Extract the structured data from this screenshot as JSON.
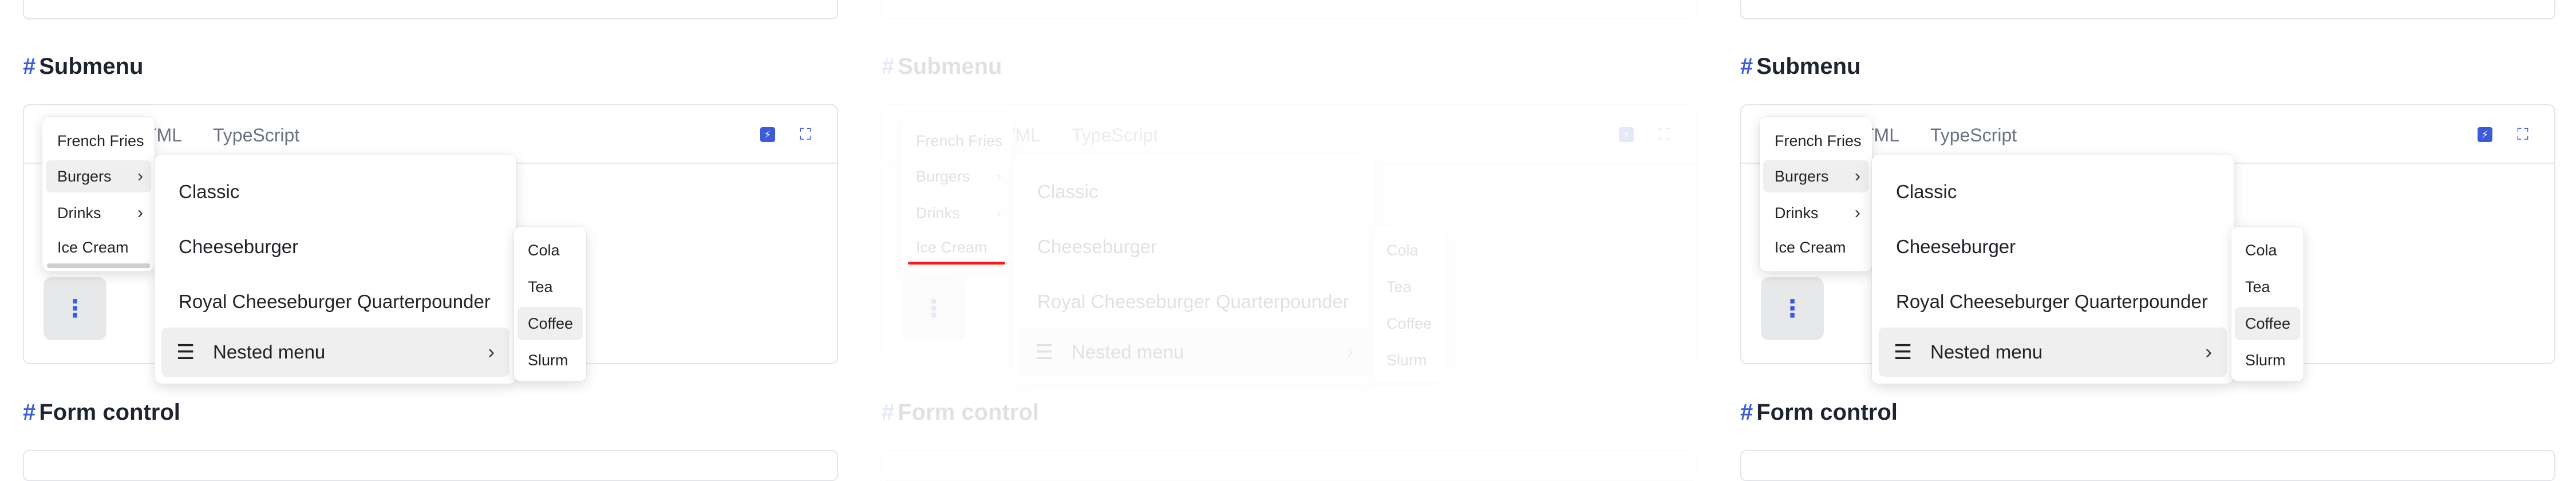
{
  "heading_hash": "#",
  "sections": {
    "submenu_title": "Submenu",
    "form_control_title": "Form control"
  },
  "header": {
    "tab_html": "TML",
    "tab_ts": "TypeScript"
  },
  "menus": {
    "level1": [
      {
        "label": "French Fries",
        "has_submenu": false
      },
      {
        "label": "Burgers",
        "has_submenu": true
      },
      {
        "label": "Drinks",
        "has_submenu": true
      },
      {
        "label": "Ice Cream",
        "has_submenu": false
      }
    ],
    "level2": [
      {
        "label": "Classic"
      },
      {
        "label": "Cheeseburger"
      },
      {
        "label": "Royal Cheeseburger Quarterpounder"
      },
      {
        "label": "Nested menu"
      }
    ],
    "level3": [
      {
        "label": "Cola"
      },
      {
        "label": "Tea"
      },
      {
        "label": "Coffee"
      },
      {
        "label": "Slurm"
      }
    ]
  },
  "icons": {
    "kebab": "⋮",
    "chevron": "›",
    "hamburger": "☰",
    "bolt": "⚡",
    "expand": "⛶"
  },
  "colors": {
    "accent": "#3b5bdb",
    "highlight": "#efefef",
    "faded_chevron": "#ff6a00",
    "focus_underline": "#ff1a1a"
  }
}
